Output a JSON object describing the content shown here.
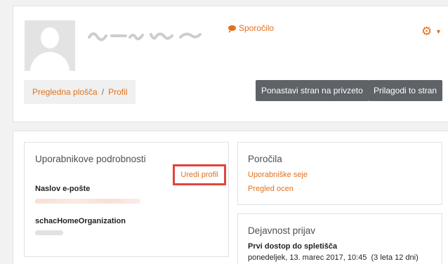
{
  "header": {
    "message_link": "Sporočilo",
    "breadcrumb": [
      "Pregledna plošča",
      "Profil"
    ],
    "breadcrumb_separator": "/",
    "buttons": {
      "reset": "Ponastavi stran na privzeto",
      "customize": "Prilagodi to stran"
    },
    "icons": {
      "message": "speech-bubble-icon",
      "settings": "gear-icon"
    }
  },
  "user_details": {
    "title": "Uporabnikove podrobnosti",
    "edit_profile": "Uredi profil",
    "email_label": "Naslov e-pošte",
    "org_label": "schacHomeOrganization"
  },
  "reports": {
    "title": "Poročila",
    "links": [
      "Uporabniške seje",
      "Pregled ocen"
    ]
  },
  "login_activity": {
    "title": "Dejavnost prijav",
    "first_access_label": "Prvi dostop do spletišča",
    "first_access_value": "ponedeljek, 13. marec 2017, 10:45  (3 leta 12 dni)"
  },
  "colors": {
    "accent": "#e2711d",
    "highlight": "#e1453d",
    "button": "#5f6368"
  }
}
